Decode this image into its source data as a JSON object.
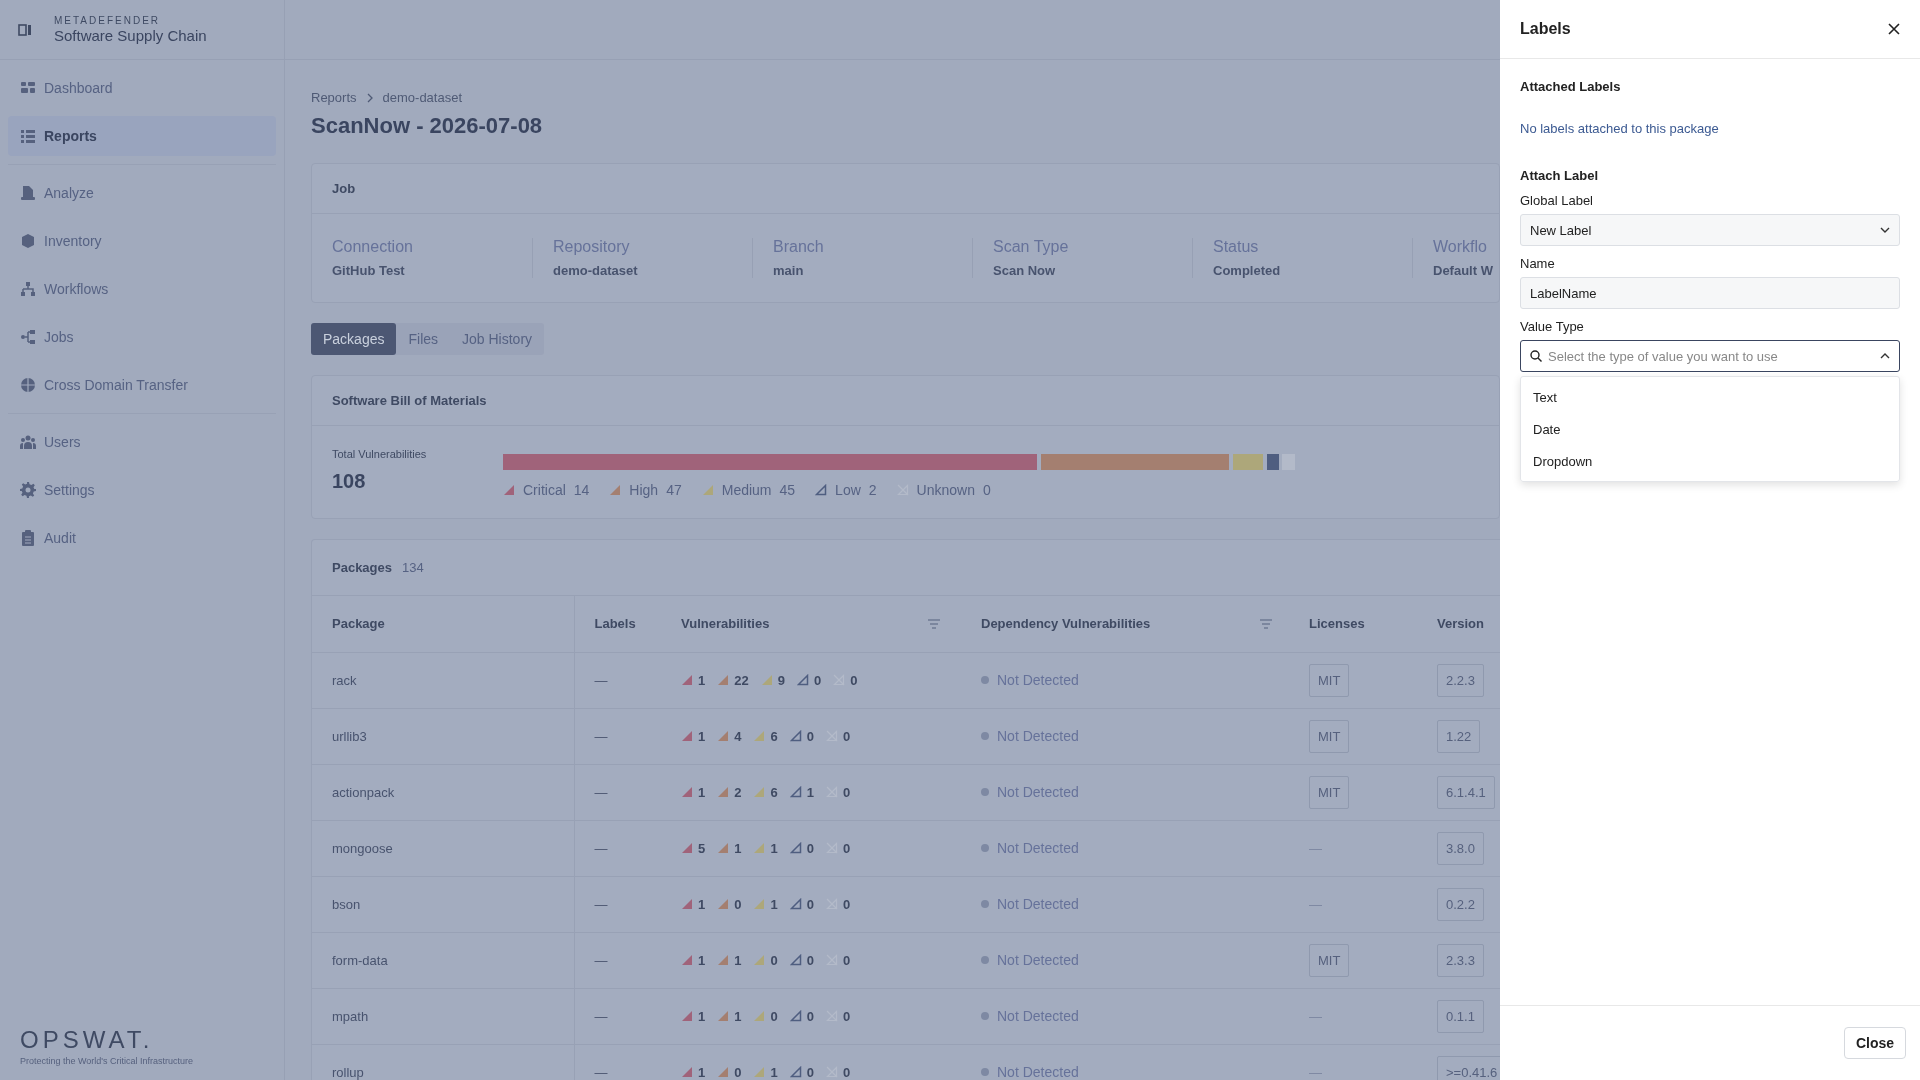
{
  "app": {
    "brand_small": "METADEFENDER",
    "brand": "Software Supply Chain"
  },
  "sidebar": {
    "groups": [
      {
        "items": [
          {
            "label": "Dashboard",
            "selected": false
          },
          {
            "label": "Reports",
            "selected": true
          }
        ]
      },
      {
        "items": [
          {
            "label": "Analyze",
            "selected": false
          },
          {
            "label": "Inventory",
            "selected": false
          },
          {
            "label": "Workflows",
            "selected": false
          },
          {
            "label": "Jobs",
            "selected": false
          },
          {
            "label": "Cross Domain Transfer",
            "selected": false
          }
        ]
      },
      {
        "items": [
          {
            "label": "Users",
            "selected": false
          },
          {
            "label": "Settings",
            "selected": false
          },
          {
            "label": "Audit",
            "selected": false
          }
        ]
      }
    ]
  },
  "footer": {
    "logo": "OPSWAT.",
    "tagline": "Protecting the World's Critical Infrastructure"
  },
  "breadcrumb": [
    "Reports",
    "demo-dataset"
  ],
  "title": "ScanNow - 2026-07-08",
  "job": {
    "title": "Job",
    "fields": [
      {
        "label": "Connection",
        "value": "GitHub Test"
      },
      {
        "label": "Repository",
        "value": "demo-dataset"
      },
      {
        "label": "Branch",
        "value": "main"
      },
      {
        "label": "Scan Type",
        "value": "Scan Now"
      },
      {
        "label": "Status",
        "value": "Completed"
      },
      {
        "label": "Workflo",
        "value": "Default W"
      }
    ]
  },
  "tabs": [
    {
      "label": "Packages",
      "selected": true
    },
    {
      "label": "Files",
      "selected": false
    },
    {
      "label": "Job History",
      "selected": false
    }
  ],
  "sbom": {
    "title": "Software Bill of Materials",
    "total_label": "Total Vulnerabilities",
    "total": "108",
    "legend": [
      {
        "kind": "triangle",
        "color": "#a0637a",
        "label": "Critical",
        "count": "14"
      },
      {
        "kind": "triangle",
        "color": "#a47f70",
        "label": "High",
        "count": "47"
      },
      {
        "kind": "triangle",
        "color": "#ada77a",
        "label": "Medium",
        "count": "45"
      },
      {
        "kind": "outline",
        "color": "#4f5e80",
        "label": "Low",
        "count": "2"
      },
      {
        "kind": "crossed",
        "color": "#b3bac9",
        "label": "Unknown",
        "count": "0"
      }
    ]
  },
  "packages": {
    "title": "Packages",
    "count": "134",
    "columns": [
      {
        "label": "Package",
        "filter": false
      },
      {
        "label": "Labels",
        "filter": false
      },
      {
        "label": "Vulnerabilities",
        "filter": true
      },
      {
        "label": "Dependency Vulnerabilities",
        "filter": true
      },
      {
        "label": "Licenses",
        "filter": false
      },
      {
        "label": "Version",
        "filter": false
      }
    ],
    "rows": [
      {
        "package": "rack",
        "labels": "—",
        "vulnerabilities": [
          "1",
          "22",
          "9",
          "0",
          "0"
        ],
        "dependency": "Not Detected",
        "license": {
          "kind": "tag",
          "text": "MIT"
        },
        "version": "2.2.3"
      },
      {
        "package": "urllib3",
        "labels": "—",
        "vulnerabilities": [
          "1",
          "4",
          "6",
          "0",
          "0"
        ],
        "dependency": "Not Detected",
        "license": {
          "kind": "tag",
          "text": "MIT"
        },
        "version": "1.22"
      },
      {
        "package": "actionpack",
        "labels": "—",
        "vulnerabilities": [
          "1",
          "2",
          "6",
          "1",
          "0"
        ],
        "dependency": "Not Detected",
        "license": {
          "kind": "tag",
          "text": "MIT"
        },
        "version": "6.1.4.1"
      },
      {
        "package": "mongoose",
        "labels": "—",
        "vulnerabilities": [
          "5",
          "1",
          "1",
          "0",
          "0"
        ],
        "dependency": "Not Detected",
        "license": {
          "kind": "empty",
          "text": "—"
        },
        "version": "3.8.0"
      },
      {
        "package": "bson",
        "labels": "—",
        "vulnerabilities": [
          "1",
          "0",
          "1",
          "0",
          "0"
        ],
        "dependency": "Not Detected",
        "license": {
          "kind": "empty",
          "text": "—"
        },
        "version": "0.2.2"
      },
      {
        "package": "form-data",
        "labels": "—",
        "vulnerabilities": [
          "1",
          "1",
          "0",
          "0",
          "0"
        ],
        "dependency": "Not Detected",
        "license": {
          "kind": "tag",
          "text": "MIT"
        },
        "version": "2.3.3"
      },
      {
        "package": "mpath",
        "labels": "—",
        "vulnerabilities": [
          "1",
          "1",
          "0",
          "0",
          "0"
        ],
        "dependency": "Not Detected",
        "license": {
          "kind": "empty",
          "text": "—"
        },
        "version": "0.1.1"
      },
      {
        "package": "rollup",
        "labels": "—",
        "vulnerabilities": [
          "1",
          "0",
          "1",
          "0",
          "0"
        ],
        "dependency": "Not Detected",
        "license": {
          "kind": "empty",
          "text": "—"
        },
        "version": ">=0.41.6"
      }
    ]
  },
  "drawer": {
    "title": "Labels",
    "attached_title": "Attached Labels",
    "attached_empty": "No labels attached to this package",
    "attach_title": "Attach Label",
    "fields": [
      {
        "kind": "select",
        "label": "Global Label",
        "value": "New Label"
      },
      {
        "kind": "text",
        "label": "Name",
        "value": "LabelName"
      },
      {
        "kind": "search",
        "label": "Value Type",
        "placeholder": "Select the type of value you want to use",
        "expanded": true,
        "options": [
          "Text",
          "Date",
          "Dropdown"
        ]
      }
    ],
    "close_button": "Close"
  }
}
